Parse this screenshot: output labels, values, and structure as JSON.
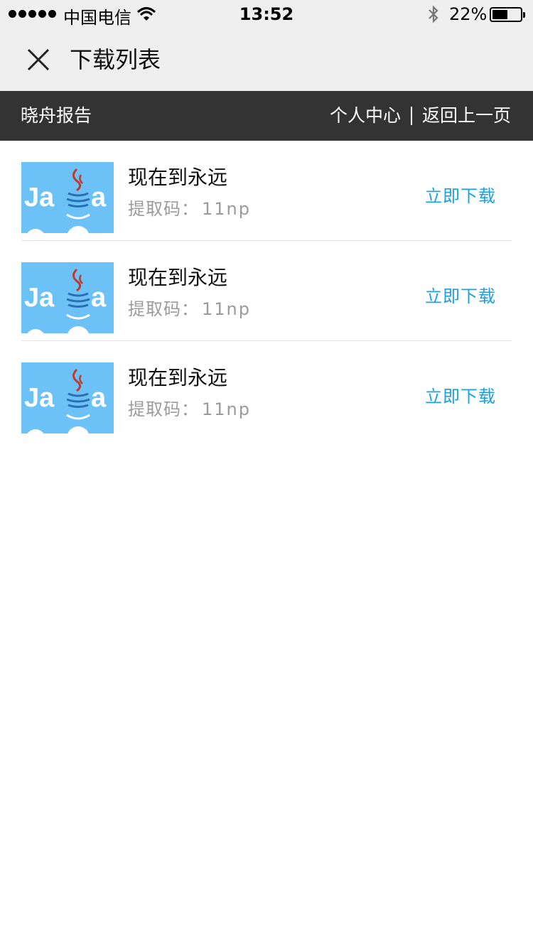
{
  "status_bar": {
    "carrier": "中国电信",
    "time": "13:52",
    "battery_percent": "22%",
    "battery_level": 0.22,
    "icons": [
      "signal-dots-icon",
      "wifi-icon",
      "bluetooth-icon",
      "battery-icon"
    ]
  },
  "nav": {
    "close_icon": "close-icon",
    "title": "下载列表"
  },
  "header": {
    "site_name": "晓舟报告",
    "link_personal": "个人中心",
    "link_back": "返回上一页",
    "background": "#333333"
  },
  "items": [
    {
      "title": "现在到永远",
      "code_label": "提取码：",
      "code_value": "11np",
      "download_label": "立即下载"
    },
    {
      "title": "现在到永远",
      "code_label": "提取码：",
      "code_value": "11np",
      "download_label": "立即下载"
    },
    {
      "title": "现在到永远",
      "code_label": "提取码：",
      "code_value": "11np",
      "download_label": "立即下载"
    }
  ],
  "thumbnail": {
    "logo_text": "Java",
    "background": "#6cc1f6"
  },
  "colors": {
    "accent": "#1aa0e6",
    "muted": "#9b9b9b",
    "nav_bg": "#efefef"
  }
}
